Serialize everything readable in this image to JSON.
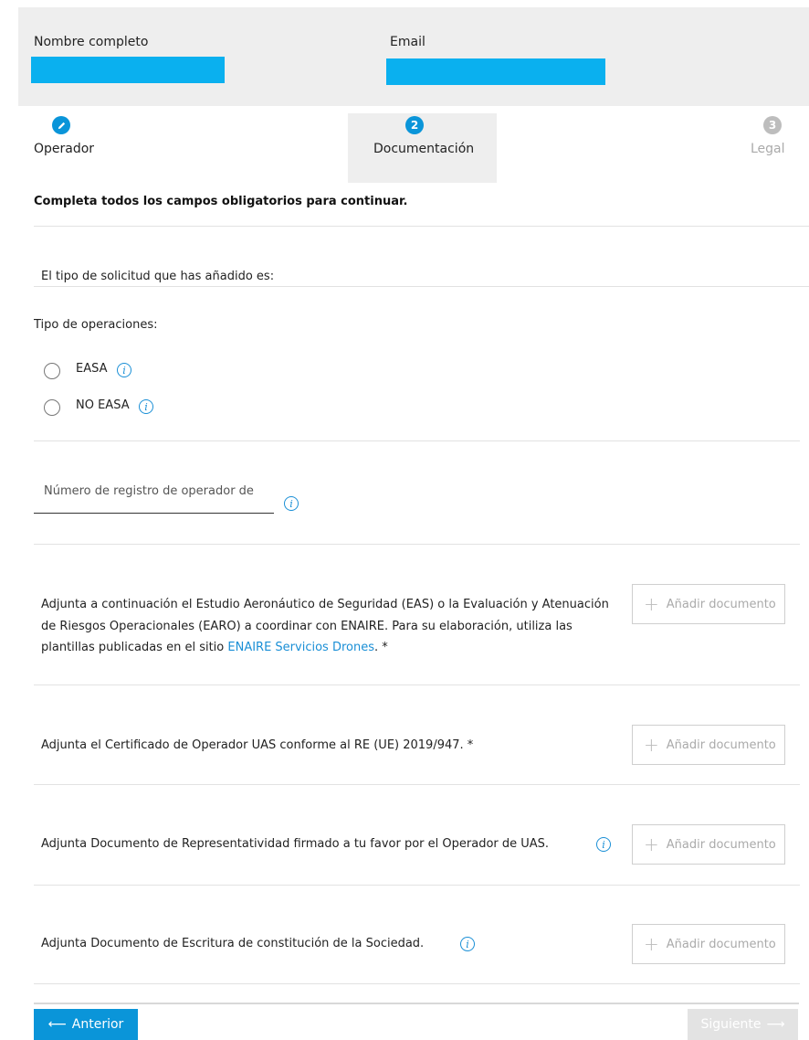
{
  "header": {
    "name_label": "Nombre completo",
    "email_label": "Email",
    "accent_color": "#0ab0ef"
  },
  "stepper": {
    "steps": [
      {
        "number": "",
        "label": "Operador",
        "state": "done"
      },
      {
        "number": "2",
        "label": "Documentación",
        "state": "active"
      },
      {
        "number": "3",
        "label": "Legal",
        "state": "pending"
      }
    ]
  },
  "intro": "Completa todos los campos obligatorios para continuar.",
  "request_type_text": "El tipo de solicitud que has añadido es:",
  "operations": {
    "label": "Tipo de operaciones:",
    "options": [
      "EASA",
      "NO EASA"
    ]
  },
  "registration_field": {
    "placeholder": "Número de registro de operador de"
  },
  "documents": [
    {
      "text_before_link": "Adjunta a continuación el Estudio Aeronáutico de Seguridad (EAS) o la Evaluación y Atenuación de Riesgos Operacionales (EARO) a coordinar con ENAIRE. Para su elaboración, utiliza las plantillas publicadas en el sitio ",
      "link": "ENAIRE Servicios Drones",
      "text_after_link": ". *",
      "button": "Añadir documento"
    },
    {
      "text": "Adjunta el Certificado de Operador UAS conforme al RE (UE) 2019/947. *",
      "button": "Añadir documento"
    },
    {
      "text": "Adjunta Documento de Representatividad firmado a tu favor por el Operador de UAS.",
      "button": "Añadir documento"
    },
    {
      "text": "Adjunta Documento de Escritura de constitución de la Sociedad.",
      "button": "Añadir documento"
    }
  ],
  "nav": {
    "prev": "Anterior",
    "next": "Siguiente"
  },
  "colors": {
    "primary": "#0a95d9",
    "link": "#1a8fd6",
    "disabled": "#e3e3e3"
  }
}
